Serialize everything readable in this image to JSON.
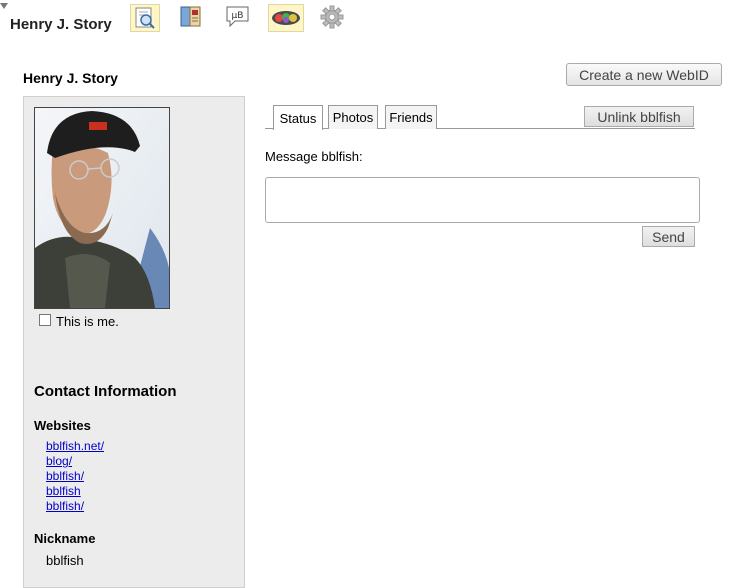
{
  "toolbar": {
    "title": "Henry J. Story",
    "tools": [
      {
        "icon": "search-document-icon",
        "highlighted": true
      },
      {
        "icon": "address-book-icon",
        "highlighted": false
      },
      {
        "icon": "microblog-icon",
        "label": "µB",
        "highlighted": false
      },
      {
        "icon": "people-groups-icon",
        "highlighted": true
      },
      {
        "icon": "gear-icon",
        "highlighted": false
      }
    ]
  },
  "profile": {
    "name": "Henry J. Story",
    "this_is_me": "This is me.",
    "contact_heading": "Contact Information",
    "websites_heading": "Websites",
    "websites": [
      "bblfish.net/",
      "blog/",
      "bblfish/",
      "bblfish",
      "bblfish/"
    ],
    "nickname_heading": "Nickname",
    "nickname": "bblfish"
  },
  "actions": {
    "create_webid": "Create a new WebID",
    "unlink": "Unlink bblfish",
    "send": "Send"
  },
  "tabs": [
    {
      "label": "Status",
      "active": true
    },
    {
      "label": "Photos",
      "active": false
    },
    {
      "label": "Friends",
      "active": false
    }
  ],
  "message": {
    "label": "Message bblfish:",
    "value": ""
  },
  "colors": {
    "link": "#0000cc",
    "panel_bg": "#ececec",
    "tool_highlight": "#fff6c8"
  }
}
